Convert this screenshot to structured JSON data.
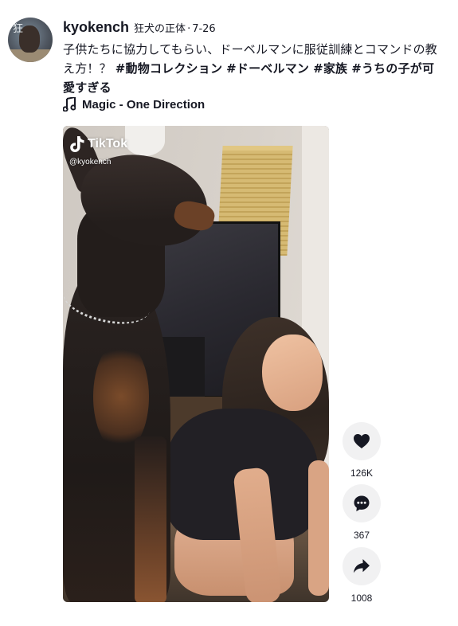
{
  "author": {
    "avatar_glyph": "狂",
    "username": "kyokench",
    "nickname": "狂犬の正体",
    "separator": "·",
    "date": "7-26"
  },
  "description": {
    "text": "子供たちに協力してもらい、ドーベルマンに服従訓練とコマンドの教え方！？",
    "hashtags": [
      "#動物コレクション",
      "#ドーベルマン",
      "#家族",
      "#うちの子が可愛すぎる"
    ]
  },
  "music": {
    "icon": "music-note-icon",
    "title": "Magic - One Direction"
  },
  "video": {
    "watermark_brand": "TikTok",
    "watermark_handle": "@kyokench"
  },
  "actions": [
    {
      "name": "like",
      "icon": "heart-icon",
      "count": "126K"
    },
    {
      "name": "comment",
      "icon": "comment-icon",
      "count": "367"
    },
    {
      "name": "share",
      "icon": "share-icon",
      "count": "1008"
    }
  ],
  "colors": {
    "text": "#161823",
    "action_button_bg": "#f1f1f2"
  }
}
